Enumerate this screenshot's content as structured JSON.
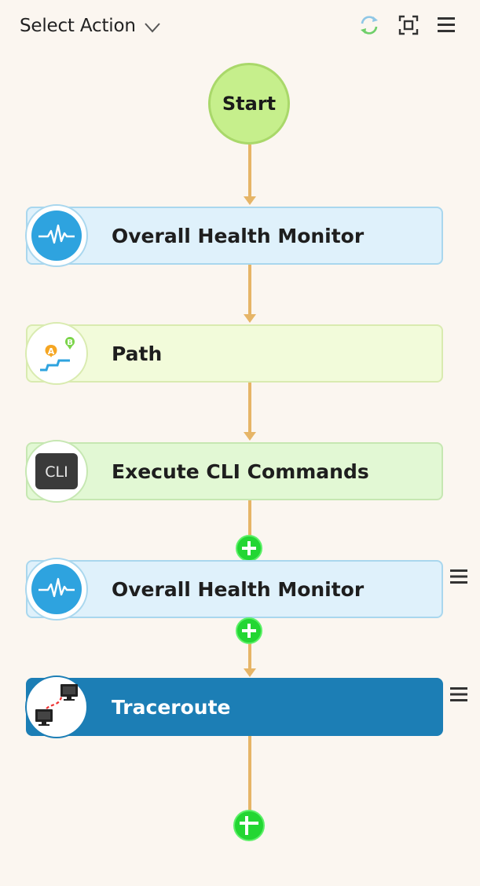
{
  "toolbar": {
    "select_action_label": "Select Action",
    "icons": [
      "chevron-down-icon",
      "refresh-icon",
      "fit-to-screen-icon",
      "hamburger-menu-icon"
    ]
  },
  "flow": {
    "start_label": "Start",
    "nodes": [
      {
        "label": "Overall Health Monitor",
        "icon": "health-monitor-icon",
        "color": "#dff1fb"
      },
      {
        "label": "Path",
        "icon": "path-icon",
        "color": "#f2fbda"
      },
      {
        "label": "Execute CLI Commands",
        "icon": "cli-icon",
        "icon_text": "CLI",
        "color": "#e2f8d4"
      },
      {
        "label": "Overall Health Monitor",
        "icon": "health-monitor-icon",
        "color": "#dff1fb",
        "has_menu": true
      },
      {
        "label": "Traceroute",
        "icon": "traceroute-icon",
        "color": "#1c7eb5",
        "selected": true,
        "has_menu": true
      }
    ],
    "path_icon_letters": [
      "A",
      "B"
    ]
  },
  "colors": {
    "background": "#fbf6f0",
    "connector": "#e6b567",
    "add_button": "#23d633",
    "start_fill": "#c6ef8c",
    "selected_node": "#1c7eb5"
  }
}
